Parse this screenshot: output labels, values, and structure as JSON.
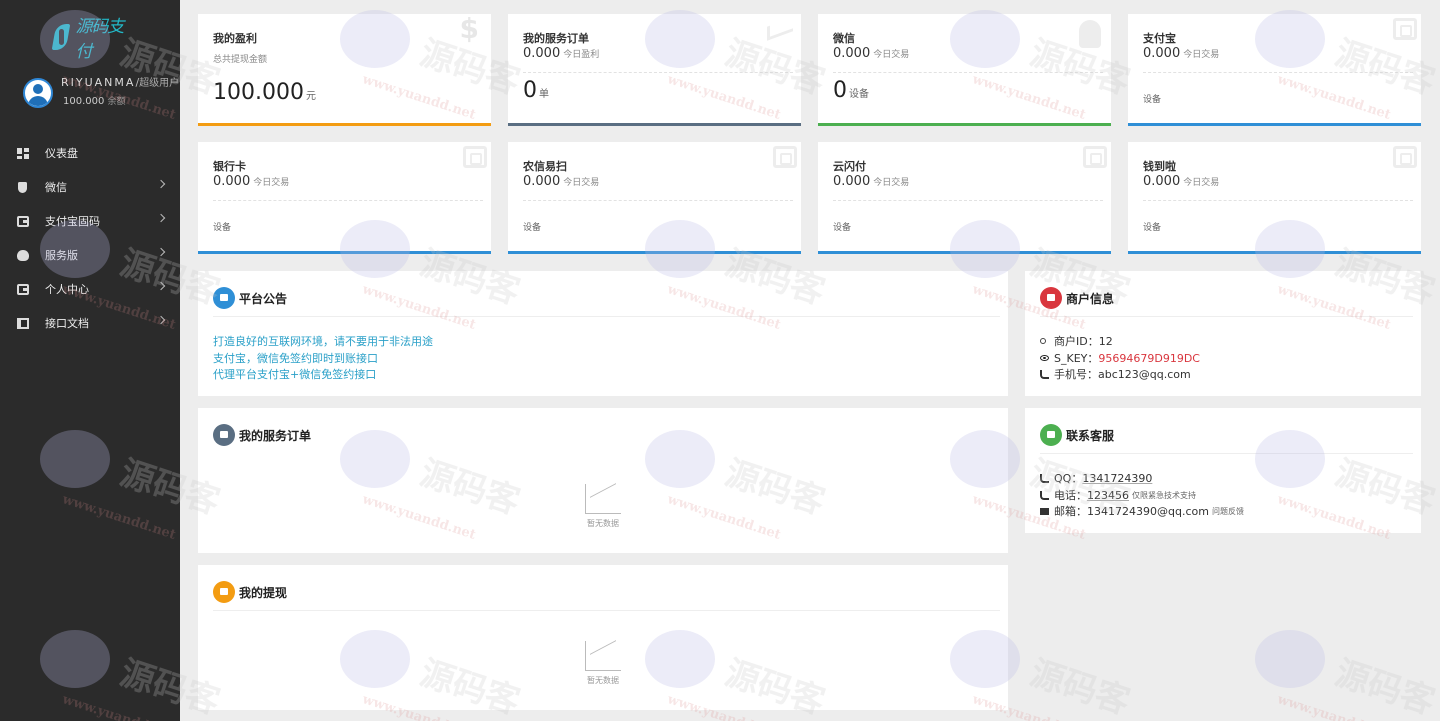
{
  "sidebar": {
    "logo_text": "源码支付",
    "user_name": "RIYUANMA",
    "user_sep": "/",
    "user_role": "超级用户",
    "balance_value": "100.000",
    "balance_unit": "余额",
    "items": [
      {
        "label": "仪表盘",
        "icon": "dashboard-icon",
        "has_arrow": false
      },
      {
        "label": "微信",
        "icon": "shield-icon",
        "has_arrow": true
      },
      {
        "label": "支付宝固码",
        "icon": "wallet-icon",
        "has_arrow": true
      },
      {
        "label": "服务版",
        "icon": "money-bag-icon",
        "has_arrow": true
      },
      {
        "label": "个人中心",
        "icon": "wallet-icon",
        "has_arrow": true
      },
      {
        "label": "接口文档",
        "icon": "book-icon",
        "has_arrow": true
      }
    ]
  },
  "stats": [
    {
      "title": "我的盈利",
      "sub": "总共提现金额",
      "big": "100.000",
      "big_unit": "元",
      "color": "#f39c12",
      "icon": "dollar-icon"
    },
    {
      "title": "我的服务订单",
      "line": "0.000",
      "line_unit": "今日盈利",
      "big": "0",
      "big_unit": "单",
      "color": "#5a6e82",
      "icon": "trend-icon"
    },
    {
      "title": "微信",
      "line": "0.000",
      "line_unit": "今日交易",
      "big": "0",
      "big_unit": "设备",
      "color": "#4caf50",
      "icon": "android-icon"
    },
    {
      "title": "支付宝",
      "line": "0.000",
      "line_unit": "今日交易",
      "foot": "设备",
      "color": "#2f8fd6",
      "icon": "wallet-box-icon"
    },
    {
      "title": "银行卡",
      "line": "0.000",
      "line_unit": "今日交易",
      "foot": "设备",
      "color": "#2f8fd6",
      "icon": "wallet-box-icon"
    },
    {
      "title": "农信易扫",
      "line": "0.000",
      "line_unit": "今日交易",
      "foot": "设备",
      "color": "#2f8fd6",
      "icon": "wallet-box-icon"
    },
    {
      "title": "云闪付",
      "line": "0.000",
      "line_unit": "今日交易",
      "foot": "设备",
      "color": "#2f8fd6",
      "icon": "wallet-box-icon"
    },
    {
      "title": "钱到啦",
      "line": "0.000",
      "line_unit": "今日交易",
      "foot": "设备",
      "color": "#2f8fd6",
      "icon": "wallet-box-icon"
    }
  ],
  "notice": {
    "title": "平台公告",
    "icon_color": "#2f8fd6",
    "lines": [
      "打造良好的互联网环境，请不要用于非法用途",
      "支付宝，微信免签约即时到账接口",
      "代理平台支付宝+微信免签约接口"
    ]
  },
  "orders": {
    "title": "我的服务订单",
    "icon_color": "#5a6e82",
    "empty": "暂无数据"
  },
  "withdraw": {
    "title": "我的提现",
    "icon_color": "#f39c12",
    "empty": "暂无数据"
  },
  "merchant": {
    "title": "商户信息",
    "icon_color": "#d9363e",
    "id_label": "商户ID：",
    "id_value": "12",
    "key_label": "S_KEY：",
    "key_value": "95694679D919DC",
    "phone_label": "手机号：",
    "phone_value": "abc123@qq.com"
  },
  "contact": {
    "title": "联系客服",
    "icon_color": "#4caf50",
    "qq_label": "QQ：",
    "qq_value": "1341724390",
    "tel_label": "电话：",
    "tel_value": "123456",
    "tel_note": "仅限紧急技术支持",
    "mail_label": "邮箱：",
    "mail_value": "1341724390@qq.com",
    "mail_note": "问题反馈"
  },
  "watermark": {
    "text": "源码客",
    "url": "www.yuandd.net"
  }
}
